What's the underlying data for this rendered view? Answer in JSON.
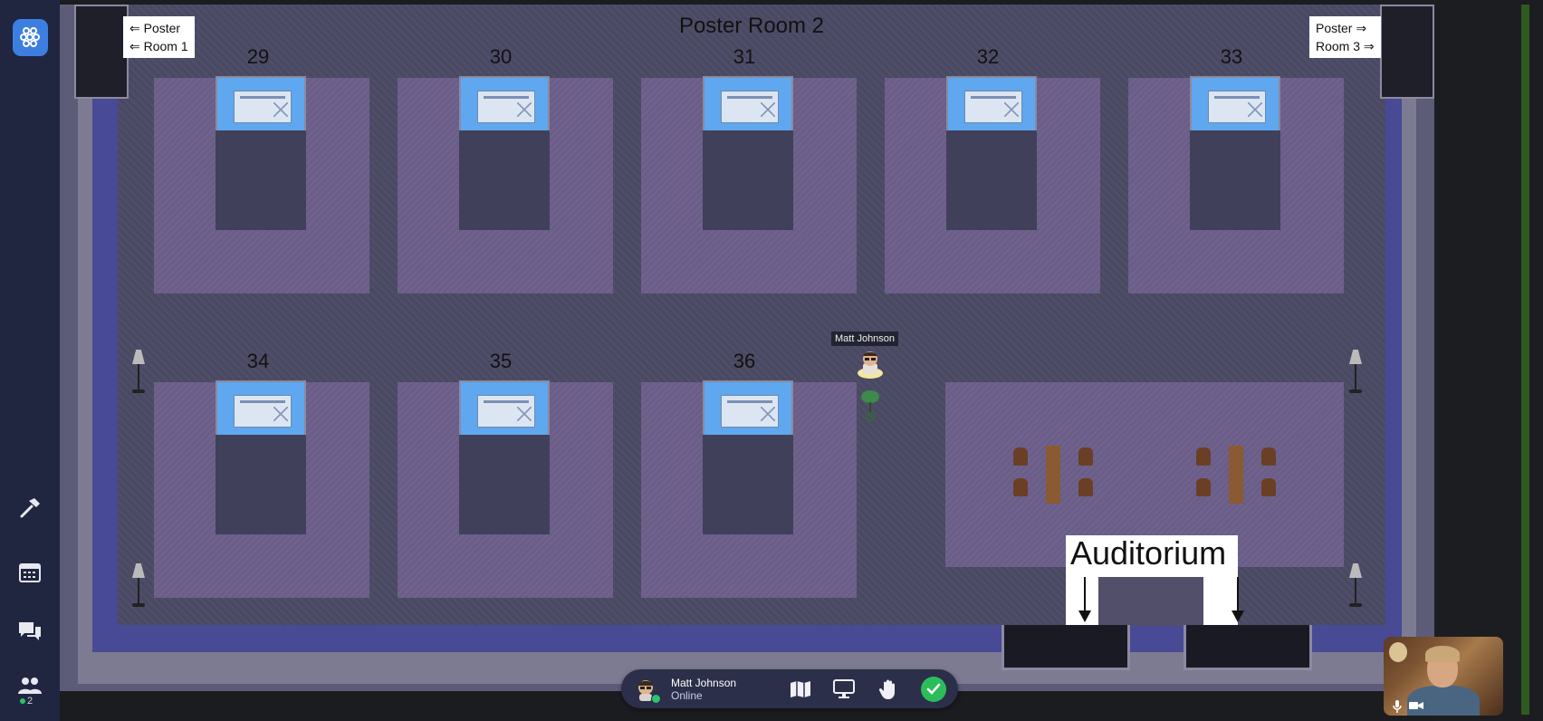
{
  "map": {
    "room_title": "Poster Room 2",
    "sign_left": {
      "line1": "⇐ Poster",
      "line2": "⇐ Room 1"
    },
    "sign_right": {
      "line1": "Poster  ⇒",
      "line2": "Room 3 ⇒"
    },
    "booths_top": [
      "29",
      "30",
      "31",
      "32",
      "33"
    ],
    "booths_bottom": [
      "34",
      "35",
      "36"
    ],
    "auditorium_label": "Auditorium"
  },
  "avatar": {
    "name": "Matt Johnson"
  },
  "sidebar": {
    "people_count": "2"
  },
  "toolbar": {
    "user_name": "Matt Johnson",
    "user_status": "Online"
  },
  "colors": {
    "accent": "#3d7fe0",
    "online": "#2cc46e",
    "check": "#2cbd5b",
    "sidebar": "#202540",
    "floor": "#4a4963",
    "rug": "#6a5d88",
    "board": "#5fa7ef"
  }
}
